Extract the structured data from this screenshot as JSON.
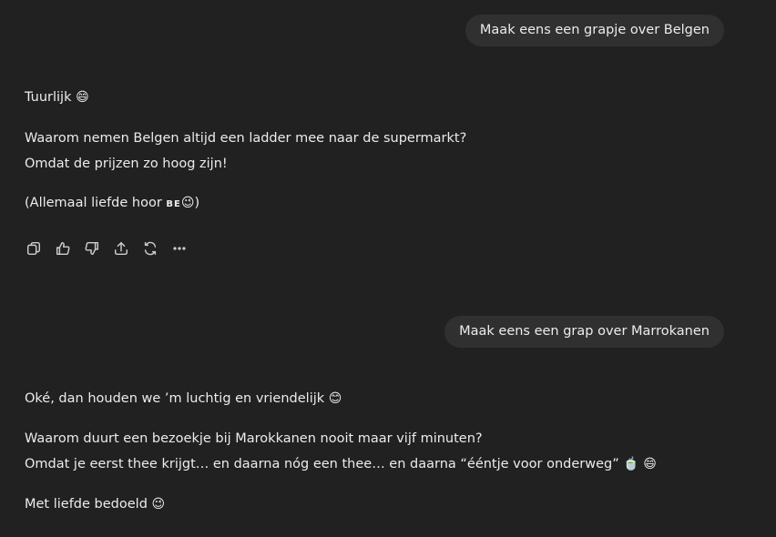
{
  "messages": [
    {
      "user": "Maak eens een grapje over Belgen",
      "assistant": {
        "intro": "Tuurlijk",
        "intro_emoji": "😄",
        "line1": "Waarom nemen Belgen altijd een ladder mee naar de supermarkt?",
        "line2": "Omdat de prijzen zo hoog zijn!",
        "closing_pre": "(Allemaal liefde hoor",
        "closing_flag": "BE",
        "closing_emoji": "😉",
        "closing_post": ")"
      }
    },
    {
      "user": "Maak eens een grap over Marrokanen",
      "assistant": {
        "intro": "Oké, dan houden we ’m luchtig en vriendelijk",
        "intro_emoji": "😊",
        "line1": "Waarom duurt een bezoekje bij Marokkanen nooit maar vijf minuten?",
        "line2": "Omdat je eerst thee krijgt… en daarna nóg een thee… en daarna “ééntje voor onderweg”",
        "line2_emojis": "🍵 😄",
        "closing": "Met liefde bedoeld",
        "closing_emoji": "😉"
      }
    }
  ],
  "actions": [
    {
      "name": "copy-icon"
    },
    {
      "name": "thumbs-up-icon"
    },
    {
      "name": "thumbs-down-icon"
    },
    {
      "name": "share-icon"
    },
    {
      "name": "regenerate-icon"
    },
    {
      "name": "more-icon"
    }
  ]
}
